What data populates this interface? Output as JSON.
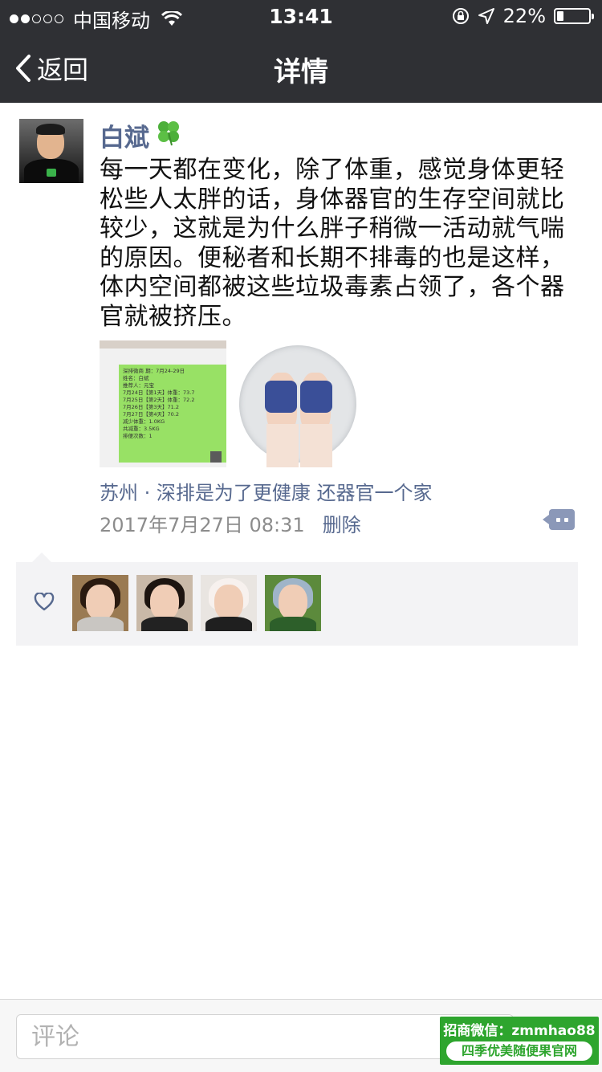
{
  "status_bar": {
    "carrier": "中国移动",
    "time": "13:41",
    "battery_percent_label": "22%",
    "battery_level": 0.22,
    "signal_bars": 2
  },
  "nav": {
    "back_label": "返回",
    "title": "详情"
  },
  "post": {
    "author": "白斌",
    "author_emoji": "🍀",
    "text": "每一天都在变化，除了体重，感觉身体更轻松些人太胖的话，身体器官的生存空间就比较少，这就是为什么胖子稍微一活动就气喘的原因。便秘者和长期不排毒的也是这样，体内空间都被这些垃圾毒素占领了，各个器官就被挤压。",
    "location": "苏州 · 深排是为了更健康 还器官一个家",
    "timestamp": "2017年7月27日 08:31",
    "delete_label": "删除",
    "photos": [
      {
        "name": "chat-screenshot",
        "lines": [
          "深排微商 期：7月24-29日",
          "姓名：白斌",
          "推荐人：元宝",
          "7月24日【第1天】体重：73.7",
          "7月25日【第2天】体重：72.2",
          "7月26日【第3天】71.2",
          "7月27日【第4天】70.2",
          "减少体重：1.0KG",
          "共减重：3.5KG",
          "排便次数：1"
        ]
      },
      {
        "name": "feet-on-scale"
      }
    ]
  },
  "likes": {
    "users": [
      {
        "name": "like-user-1",
        "bg": "#9a7a52",
        "hair": "#2a1a10",
        "body": "#c9c6c2"
      },
      {
        "name": "like-user-2",
        "bg": "#c9b9a8",
        "hair": "#1d1510",
        "body": "#222222"
      },
      {
        "name": "like-user-3",
        "bg": "#e9e5e1",
        "hair": "#f7f1ee",
        "body": "#1f1f1f"
      },
      {
        "name": "like-user-4",
        "bg": "#5c8a3c",
        "hair": "#9fb4c8",
        "body": "#2d5f2a"
      }
    ]
  },
  "comment_bar": {
    "placeholder": "评论"
  },
  "watermark": {
    "line1": "招商微信：zmmhao88",
    "line2": "四季优美随便果官网"
  },
  "colors": {
    "nav_bg": "#2f3034",
    "link_blue": "#57698f",
    "watermark_green": "#2ea52e"
  }
}
